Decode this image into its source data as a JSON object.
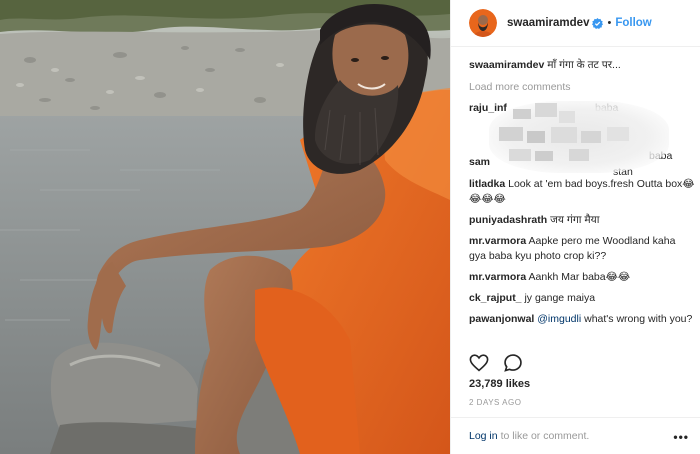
{
  "post": {
    "username": "swaamiramdev",
    "follow_label": "Follow",
    "dot": "•",
    "caption_user": "swaamiramdev",
    "caption_text": "माँ गंगा के तट पर...",
    "load_more": "Load more comments",
    "likes": "23,789 likes",
    "date": "2 DAYS AGO"
  },
  "comments": [
    {
      "user": "litladka",
      "text": "Look at 'em bad boys.fresh Outta box😂😂😂😂"
    },
    {
      "user": "puniyadashrath",
      "text": "जय गंगा मैया"
    },
    {
      "user": "mr.varmora",
      "text": "Aapke pero me Woodland kaha gya baba kyu photo crop ki??"
    },
    {
      "user": "mr.varmora",
      "text": "Aankh Mar baba😂😂"
    },
    {
      "user": "ck_rajput_",
      "text": "jy gange maiya"
    },
    {
      "user": "pawanjonwal",
      "mention": "@imgudli",
      "text": "what's wrong with you?"
    }
  ],
  "blurred": {
    "frag1": "raju_inf",
    "frag2": "baba",
    "frag3": "sam",
    "frag4": "baba",
    "frag5": "stan"
  },
  "footer": {
    "login": "Log in",
    "rest": "to like or comment.",
    "more": "•••"
  },
  "icons": {
    "verified_color": "#3897f0",
    "follow_color": "#3897f0",
    "robe_color": "#e8661c"
  }
}
